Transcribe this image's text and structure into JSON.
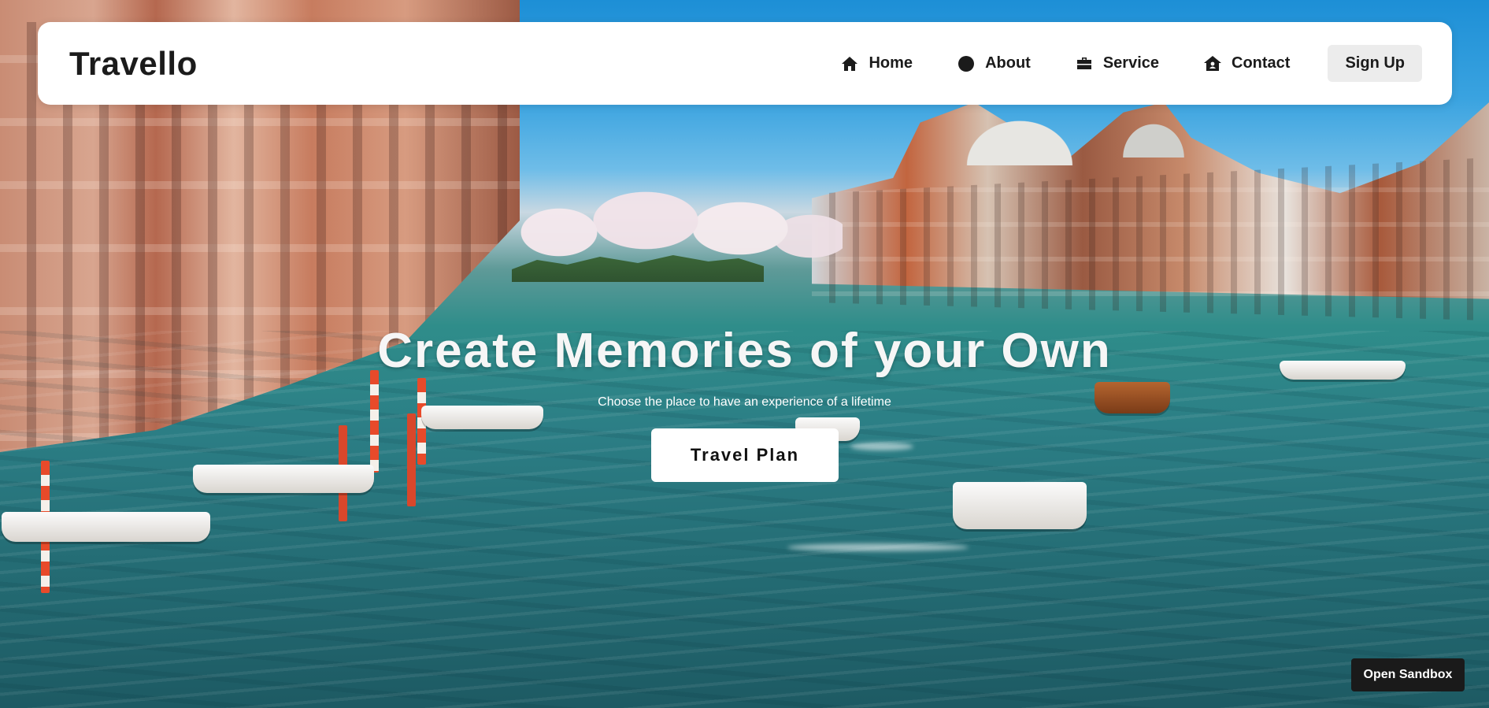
{
  "brand": {
    "name": "Travello"
  },
  "nav": {
    "items": [
      {
        "label": "Home",
        "icon": "home-icon"
      },
      {
        "label": "About",
        "icon": "circle-icon"
      },
      {
        "label": "Service",
        "icon": "briefcase-icon"
      },
      {
        "label": "Contact",
        "icon": "house-user-icon"
      }
    ],
    "signup_label": "Sign Up"
  },
  "hero": {
    "headline": "Create Memories of your Own",
    "subline": "Choose the place to have an experience of a lifetime",
    "cta_label": "Travel Plan",
    "background": "photo of Venice Grand Canal with boats"
  },
  "footer": {
    "sandbox_label": "Open Sandbox"
  },
  "colors": {
    "navbar_bg": "#ffffff",
    "text_dark": "#1b1b1b",
    "signup_bg": "#ececec",
    "cta_bg": "#ffffff",
    "sandbox_bg": "#1a1a1a"
  }
}
